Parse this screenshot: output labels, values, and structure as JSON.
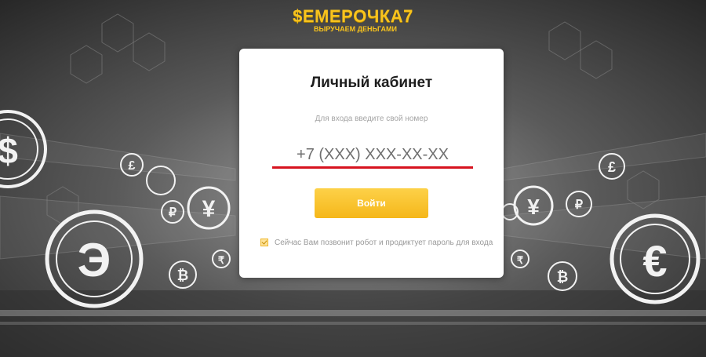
{
  "brand": {
    "name": "$EMEPOЧКА7",
    "tagline": "ВЫРУЧАЕМ ДЕНЬГАМИ"
  },
  "login_card": {
    "title": "Личный кабинет",
    "hint": "Для входа введите свой номер",
    "phone_placeholder": "+7 (XXX) XXX-XX-XX",
    "phone_value": "",
    "submit_label": "Войти",
    "notice_checked": true,
    "notice_text": "Сейчас Вам позвонит робот и продиктует пароль для входа"
  },
  "background_symbols": [
    "$",
    "£",
    "¥",
    "₽",
    "₸",
    "₿",
    "€",
    "₹",
    "Э"
  ],
  "colors": {
    "accent": "#f5b71a",
    "underline": "#d7131f",
    "background": "#3a3a3a"
  }
}
